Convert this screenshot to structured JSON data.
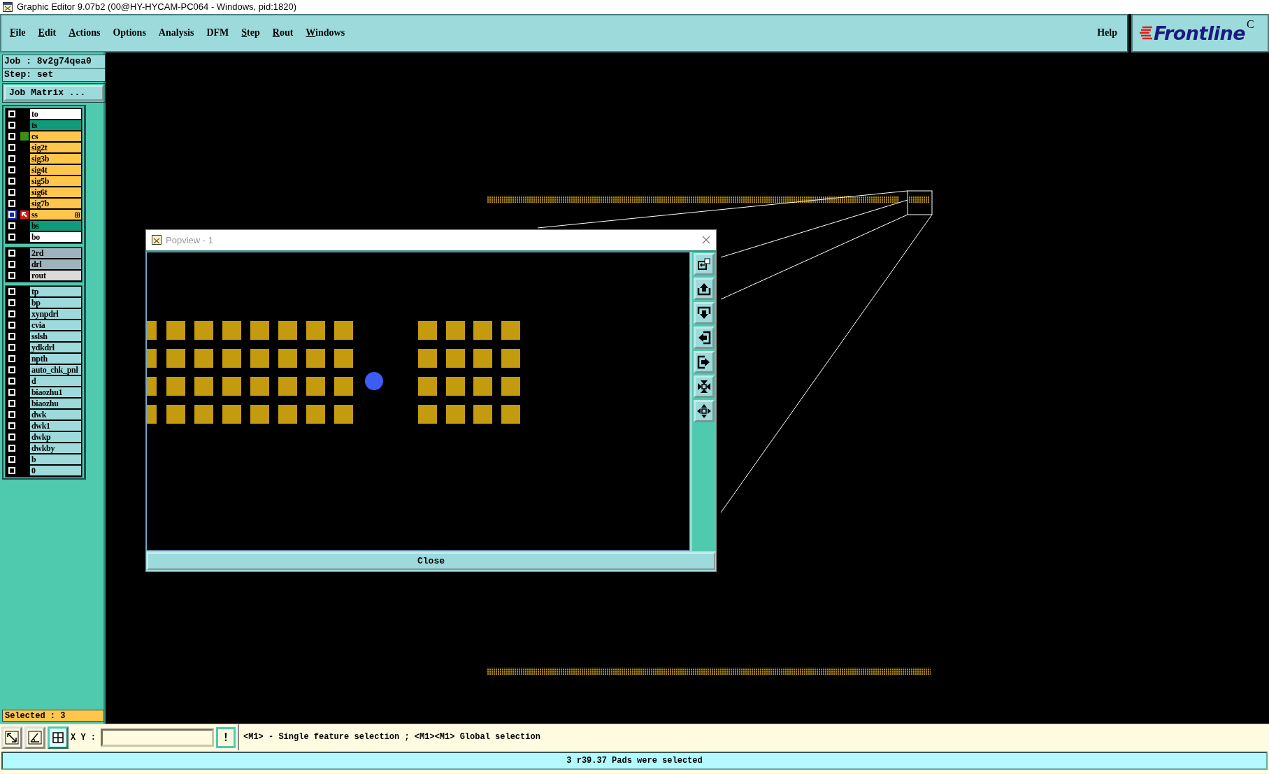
{
  "window": {
    "title": "Graphic Editor 9.07b2 (00@HY-HYCAM-PC064 - Windows, pid:1820)"
  },
  "menu": [
    {
      "label": "File",
      "mnemonic": true
    },
    {
      "label": "Edit",
      "mnemonic": true
    },
    {
      "label": "Actions",
      "mnemonic": true
    },
    {
      "label": "Options",
      "mnemonic": false
    },
    {
      "label": "Analysis",
      "mnemonic": false
    },
    {
      "label": "DFM",
      "mnemonic": false
    },
    {
      "label": "Step",
      "mnemonic": true
    },
    {
      "label": "Rout",
      "mnemonic": true
    },
    {
      "label": "Windows",
      "mnemonic": true
    }
  ],
  "help": "Help",
  "logo": {
    "text": "Frontline",
    "cut_mark": "C"
  },
  "job": {
    "job": "Job  : 8v2g74qea0",
    "step": "Step: set",
    "matrix_button": "Job Matrix ..."
  },
  "layer_groups": [
    {
      "layers": [
        {
          "name": "to",
          "color": "#ffffff",
          "selected": false,
          "displayed": false,
          "work": false
        },
        {
          "name": "ts",
          "color": "#0f9a7a",
          "selected": false,
          "displayed": false,
          "work": false
        },
        {
          "name": "cs",
          "color": "#ffc64c",
          "selected": false,
          "displayed": true,
          "work": false
        },
        {
          "name": "sig2t",
          "color": "#ffc64c",
          "selected": false,
          "displayed": false,
          "work": false
        },
        {
          "name": "sig3b",
          "color": "#ffc64c",
          "selected": false,
          "displayed": false,
          "work": false
        },
        {
          "name": "sig4t",
          "color": "#ffc64c",
          "selected": false,
          "displayed": false,
          "work": false
        },
        {
          "name": "sig5b",
          "color": "#ffc64c",
          "selected": false,
          "displayed": false,
          "work": false
        },
        {
          "name": "sig6t",
          "color": "#ffc64c",
          "selected": false,
          "displayed": false,
          "work": false
        },
        {
          "name": "sig7b",
          "color": "#ffc64c",
          "selected": false,
          "displayed": false,
          "work": false
        },
        {
          "name": "ss",
          "color": "#ffc64c",
          "selected": true,
          "displayed": false,
          "work": true
        },
        {
          "name": "bs",
          "color": "#0f9a7a",
          "selected": false,
          "displayed": false,
          "work": false
        },
        {
          "name": "bo",
          "color": "#ffffff",
          "selected": false,
          "displayed": false,
          "work": false
        }
      ]
    },
    {
      "layers": [
        {
          "name": "2rd",
          "color": "#9fb3bc",
          "selected": false,
          "displayed": false,
          "work": false
        },
        {
          "name": "drl",
          "color": "#9fb3bc",
          "selected": false,
          "displayed": false,
          "work": false
        },
        {
          "name": "rout",
          "color": "#dadada",
          "selected": false,
          "displayed": false,
          "work": false
        }
      ]
    },
    {
      "layers": [
        {
          "name": "tp",
          "color": "#9edadb",
          "selected": false,
          "displayed": false,
          "work": false
        },
        {
          "name": "bp",
          "color": "#9edadb",
          "selected": false,
          "displayed": false,
          "work": false
        },
        {
          "name": "xynpdrl",
          "color": "#9edadb",
          "selected": false,
          "displayed": false,
          "work": false
        },
        {
          "name": "cvia",
          "color": "#9edadb",
          "selected": false,
          "displayed": false,
          "work": false
        },
        {
          "name": "sslsh",
          "color": "#9edadb",
          "selected": false,
          "displayed": false,
          "work": false
        },
        {
          "name": "ydkdrl",
          "color": "#9edadb",
          "selected": false,
          "displayed": false,
          "work": false
        },
        {
          "name": "npth",
          "color": "#9edadb",
          "selected": false,
          "displayed": false,
          "work": false
        },
        {
          "name": "auto_chk_pnl",
          "color": "#9edadb",
          "selected": false,
          "displayed": false,
          "work": false
        },
        {
          "name": "d",
          "color": "#9edadb",
          "selected": false,
          "displayed": false,
          "work": false
        },
        {
          "name": "biaozhu1",
          "color": "#9edadb",
          "selected": false,
          "displayed": false,
          "work": false
        },
        {
          "name": "biaozhu",
          "color": "#9edadb",
          "selected": false,
          "displayed": false,
          "work": false
        },
        {
          "name": "dwk",
          "color": "#9edadb",
          "selected": false,
          "displayed": false,
          "work": false
        },
        {
          "name": "dwk1",
          "color": "#9edadb",
          "selected": false,
          "displayed": false,
          "work": false
        },
        {
          "name": "dwkp",
          "color": "#9edadb",
          "selected": false,
          "displayed": false,
          "work": false
        },
        {
          "name": "dwkby",
          "color": "#9edadb",
          "selected": false,
          "displayed": false,
          "work": false
        },
        {
          "name": "b",
          "color": "#9edadb",
          "selected": false,
          "displayed": false,
          "work": false
        },
        {
          "name": "0",
          "color": "#9edadb",
          "selected": false,
          "displayed": false,
          "work": false
        }
      ]
    }
  ],
  "selected_count": "Selected : 3",
  "popview": {
    "title": "Popview - 1",
    "close_button": "Close"
  },
  "toolbar": {
    "xy_label": "X Y :",
    "alert_button": "!",
    "hint": "<M1> - Single feature selection ; <M1><M1> Global selection"
  },
  "status_bar": "3 r39.37 Pads were selected"
}
